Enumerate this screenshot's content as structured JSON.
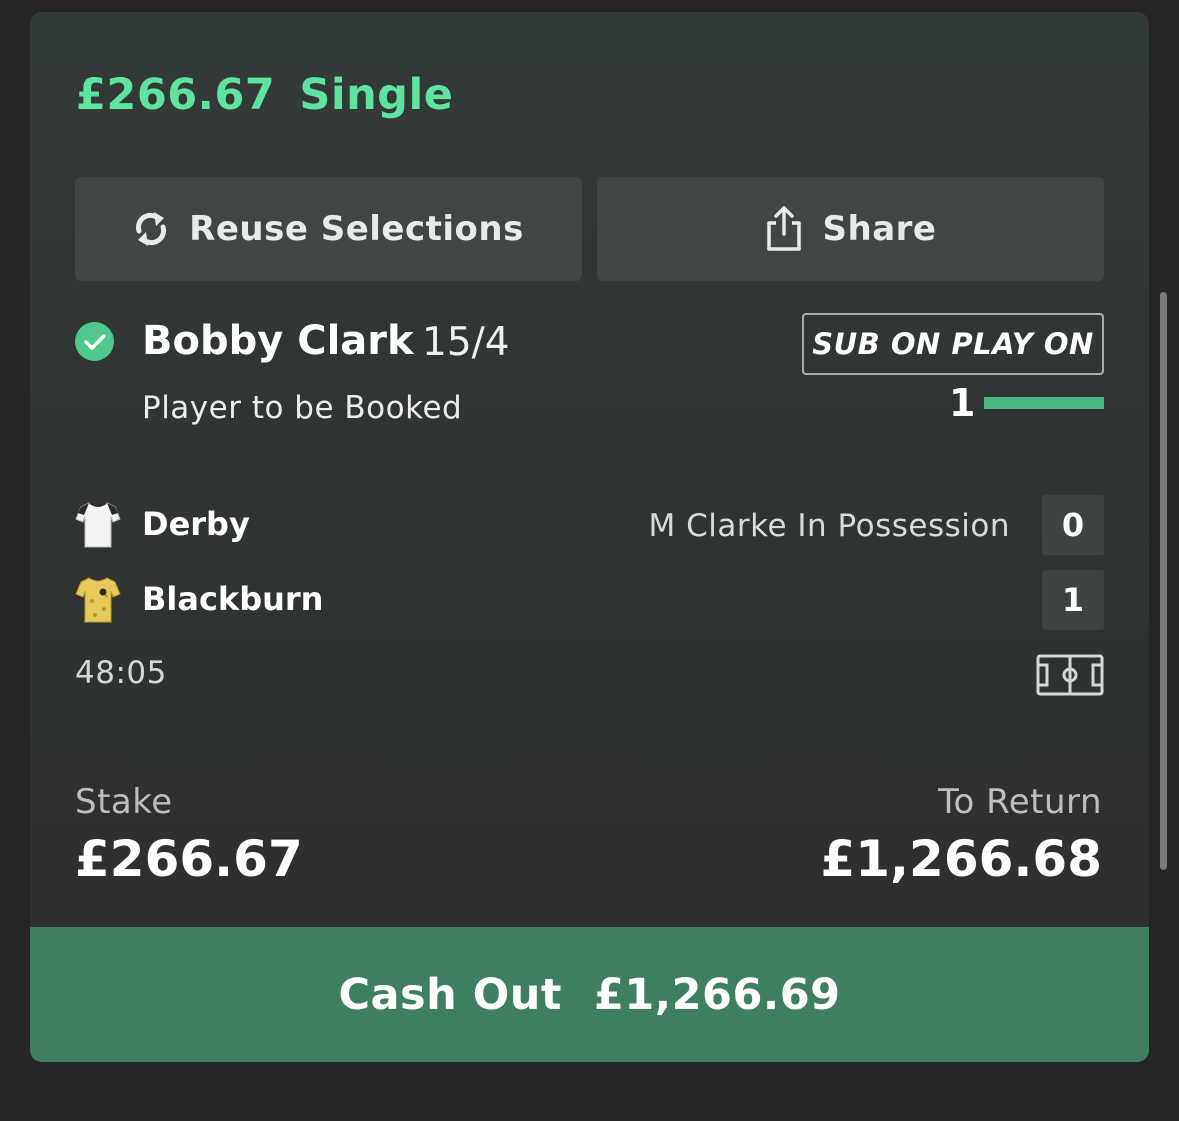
{
  "bet": {
    "stake_header": "£266.67",
    "bet_type": "Single"
  },
  "actions": {
    "reuse_label": "Reuse Selections",
    "reuse_icon": "refresh-icon",
    "share_label": "Share",
    "share_icon": "share-icon"
  },
  "selection": {
    "status_icon": "check-circle-icon",
    "name": "Bobby Clark",
    "odds": "15/4",
    "market": "Player to be Booked"
  },
  "promo": {
    "badge": "SUB ON PLAY ON",
    "count": "1",
    "progress": 1.0
  },
  "match": {
    "home": {
      "name": "Derby",
      "score": "0",
      "kit_icon": "derby-kit-icon"
    },
    "away": {
      "name": "Blackburn",
      "score": "1",
      "kit_icon": "blackburn-kit-icon"
    },
    "status": "M Clarke In Possession",
    "clock": "48:05",
    "pitch_icon": "pitch-icon"
  },
  "summary": {
    "stake_label": "Stake",
    "stake_value": "£266.67",
    "return_label": "To Return",
    "return_value": "£1,266.68"
  },
  "cashout": {
    "label": "Cash Out",
    "value": "£1,266.69"
  },
  "colors": {
    "accent_green": "#5ee3a1",
    "cashout_bg": "#3e7f61",
    "progress": "#4cb883"
  }
}
